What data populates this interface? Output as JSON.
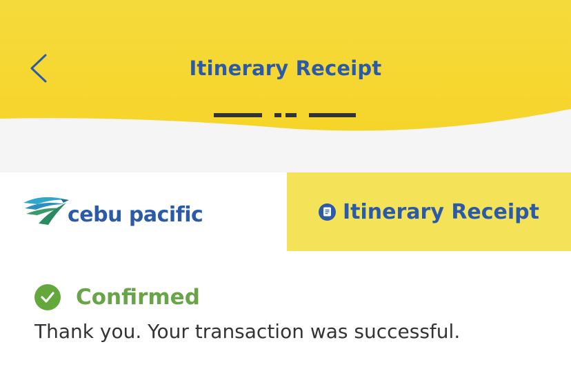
{
  "header": {
    "title": "Itinerary Receipt",
    "back_icon": "chevron-left-icon",
    "color": "#f5d92f"
  },
  "banner": {
    "logo_text": "cebu pacific",
    "tab_label": "Itinerary Receipt",
    "tab_icon": "document-icon",
    "tab_color": "#f4e258"
  },
  "status": {
    "label": "Confirmed",
    "icon": "check-circle-icon",
    "color": "#6aa449",
    "message": "Thank you. Your transaction was successful."
  }
}
